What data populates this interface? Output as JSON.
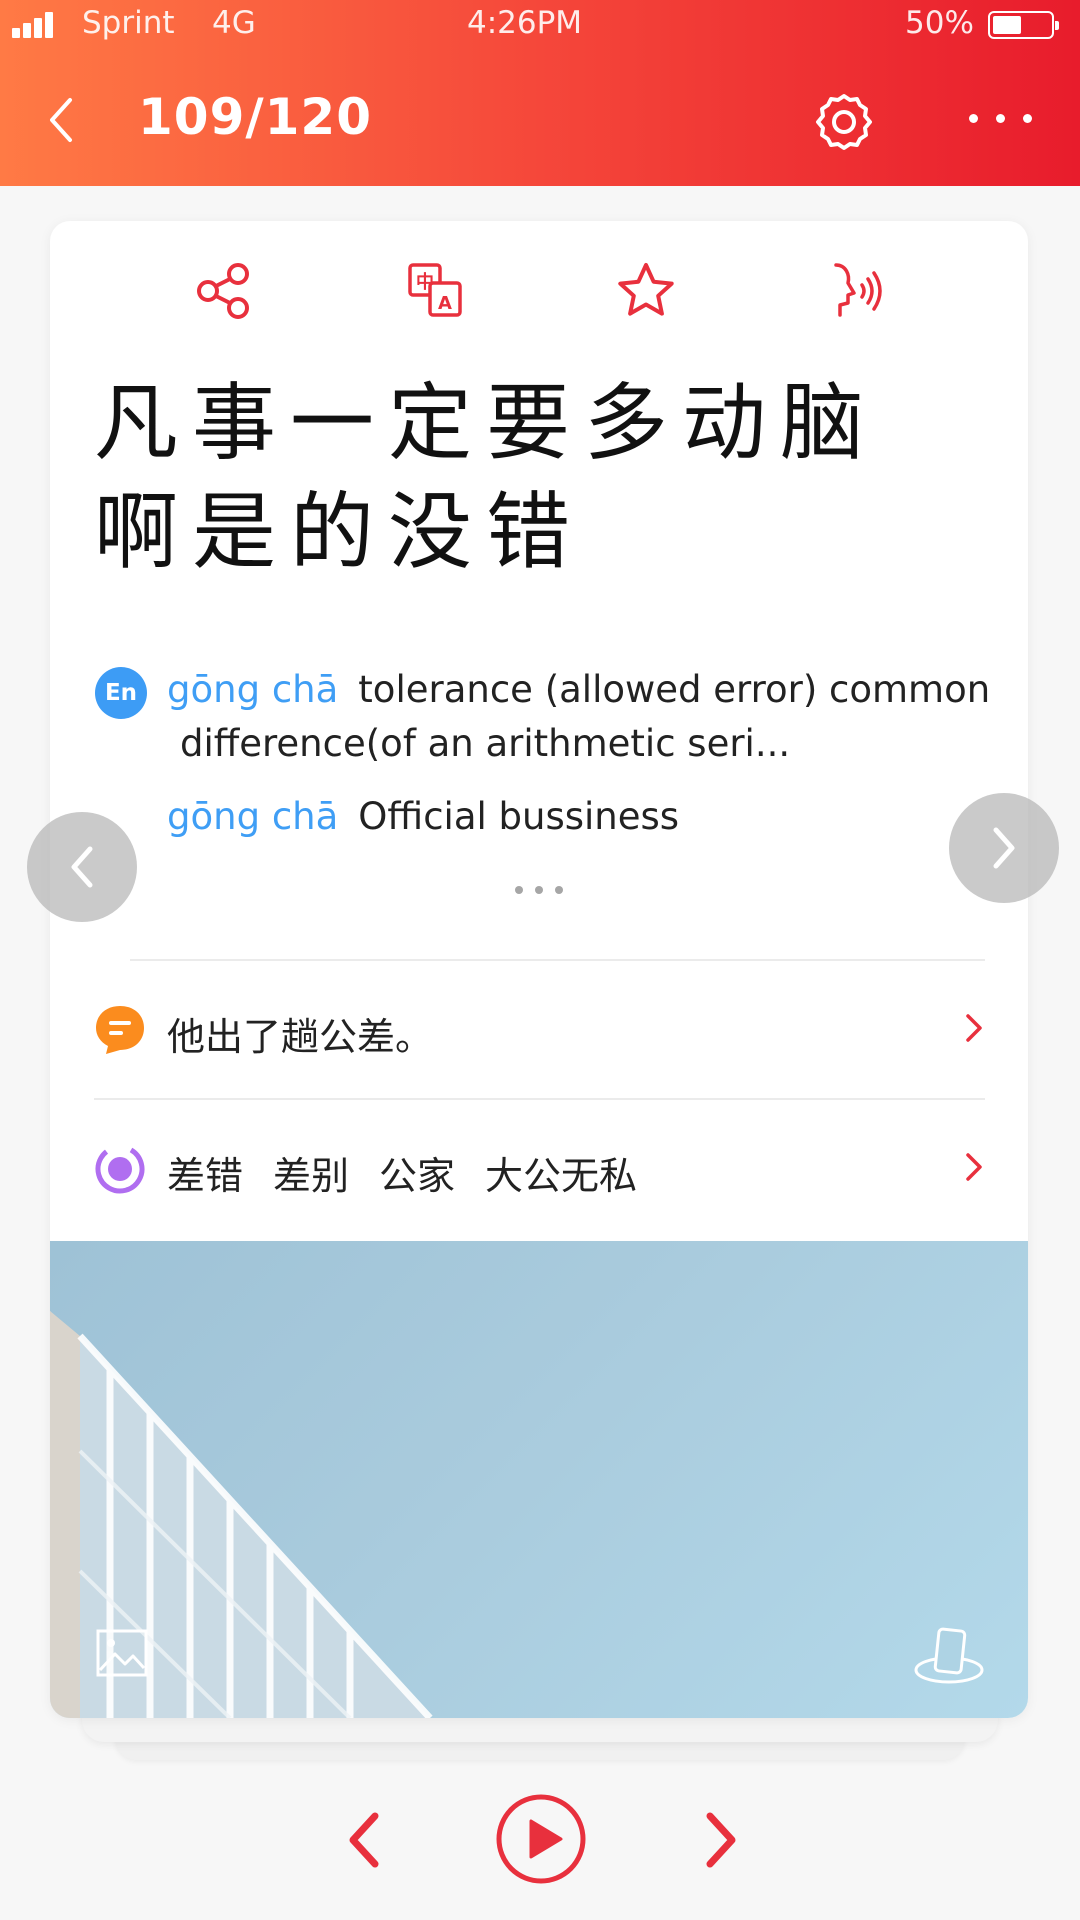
{
  "status_bar": {
    "carrier": "Sprint",
    "network": "4G",
    "time": "4:26PM",
    "battery_percent": "50%",
    "battery_level": 0.5
  },
  "header": {
    "page_counter": "109/120",
    "back_icon": "chevron-left-icon",
    "settings_icon": "gear-icon",
    "more_icon": "more-horizontal-icon"
  },
  "card": {
    "toolbar": [
      {
        "icon": "share-icon"
      },
      {
        "icon": "translate-icon"
      },
      {
        "icon": "star-icon"
      },
      {
        "icon": "speak-icon"
      }
    ],
    "hanzi_line1": "凡事一定要多动脑",
    "hanzi_line2": "啊是的没错",
    "definitions": {
      "badge": "En",
      "items": [
        {
          "pinyin": "gōng chā",
          "line1": "tolerance (allowed error) common",
          "line2": "difference(of an arithmetic seri..."
        },
        {
          "pinyin": "gōng chā",
          "line1": "Official bussiness"
        }
      ]
    },
    "example_sentence": "他出了趟公差。",
    "related_words": [
      "差错",
      "差别",
      "公家",
      "大公无私"
    ],
    "image_icon": "image-icon",
    "ar_icon": "ar-phone-icon"
  },
  "colors": {
    "accent": "#e8303d",
    "header_start": "#ff7a45",
    "header_end": "#e81c2c",
    "pinyin": "#3f9ef5",
    "example_icon": "#fb8c1e",
    "related_icon": "#b06ef0"
  }
}
